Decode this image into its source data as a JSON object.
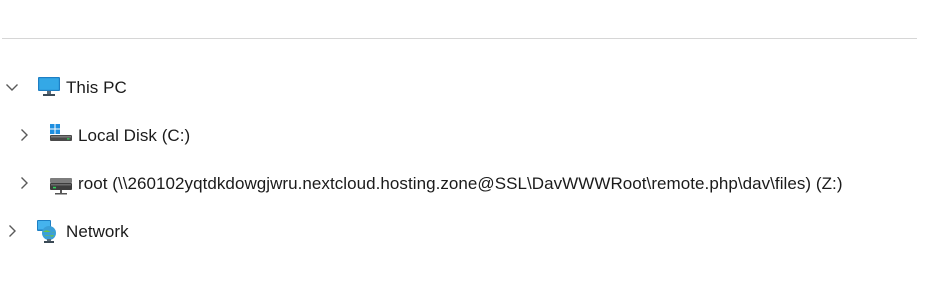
{
  "nav_tree": {
    "items": [
      {
        "label": "This PC",
        "expanded": true,
        "icon": "monitor-icon"
      },
      {
        "label": "Local Disk (C:)",
        "expanded": false,
        "icon": "windows-drive-icon"
      },
      {
        "label": "root (\\\\260102yqtdkdowgjwru.nextcloud.hosting.zone@SSL\\DavWWWRoot\\remote.php\\dav\\files) (Z:)",
        "expanded": false,
        "icon": "network-drive-icon"
      },
      {
        "label": "Network",
        "expanded": false,
        "icon": "network-icon"
      }
    ]
  }
}
